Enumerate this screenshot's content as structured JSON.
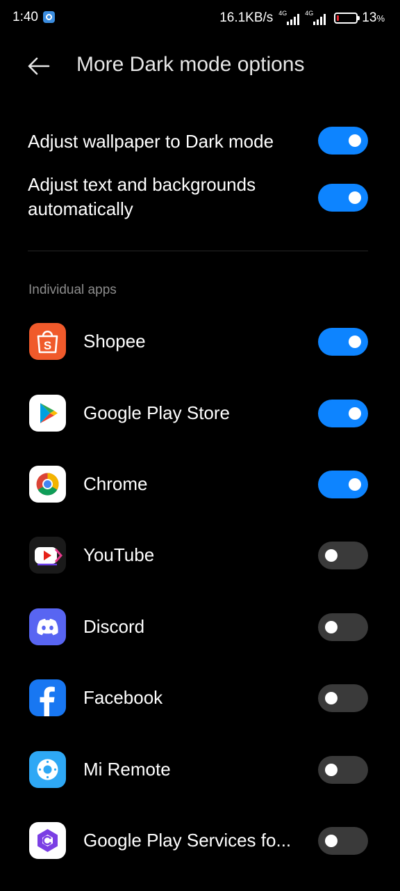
{
  "status_bar": {
    "time": "1:40",
    "net_speed": "16.1KB/s",
    "network_type": "4G",
    "battery_value": "13",
    "battery_unit": "%",
    "battery_level": 0.13,
    "battery_color": "#e8252e"
  },
  "header": {
    "title": "More Dark mode options",
    "back_icon": "back-arrow-icon"
  },
  "settings": [
    {
      "label": "Adjust wallpaper to Dark mode",
      "enabled": true
    },
    {
      "label": "Adjust text and backgrounds automatically",
      "enabled": true
    }
  ],
  "section": {
    "label": "Individual apps"
  },
  "apps": [
    {
      "name": "Shopee",
      "icon": "shopee-icon",
      "enabled": true
    },
    {
      "name": "Google Play Store",
      "icon": "play-store-icon",
      "enabled": true
    },
    {
      "name": "Chrome",
      "icon": "chrome-icon",
      "enabled": true
    },
    {
      "name": "YouTube",
      "icon": "youtube-icon",
      "enabled": false
    },
    {
      "name": "Discord",
      "icon": "discord-icon",
      "enabled": false
    },
    {
      "name": "Facebook",
      "icon": "facebook-icon",
      "enabled": false
    },
    {
      "name": "Mi Remote",
      "icon": "mi-remote-icon",
      "enabled": false
    },
    {
      "name": "Google Play Services fo...",
      "icon": "play-services-icon",
      "enabled": false
    }
  ],
  "colors": {
    "toggle_on": "#0d84ff",
    "toggle_off": "#3a3a3a",
    "background": "#000000"
  }
}
